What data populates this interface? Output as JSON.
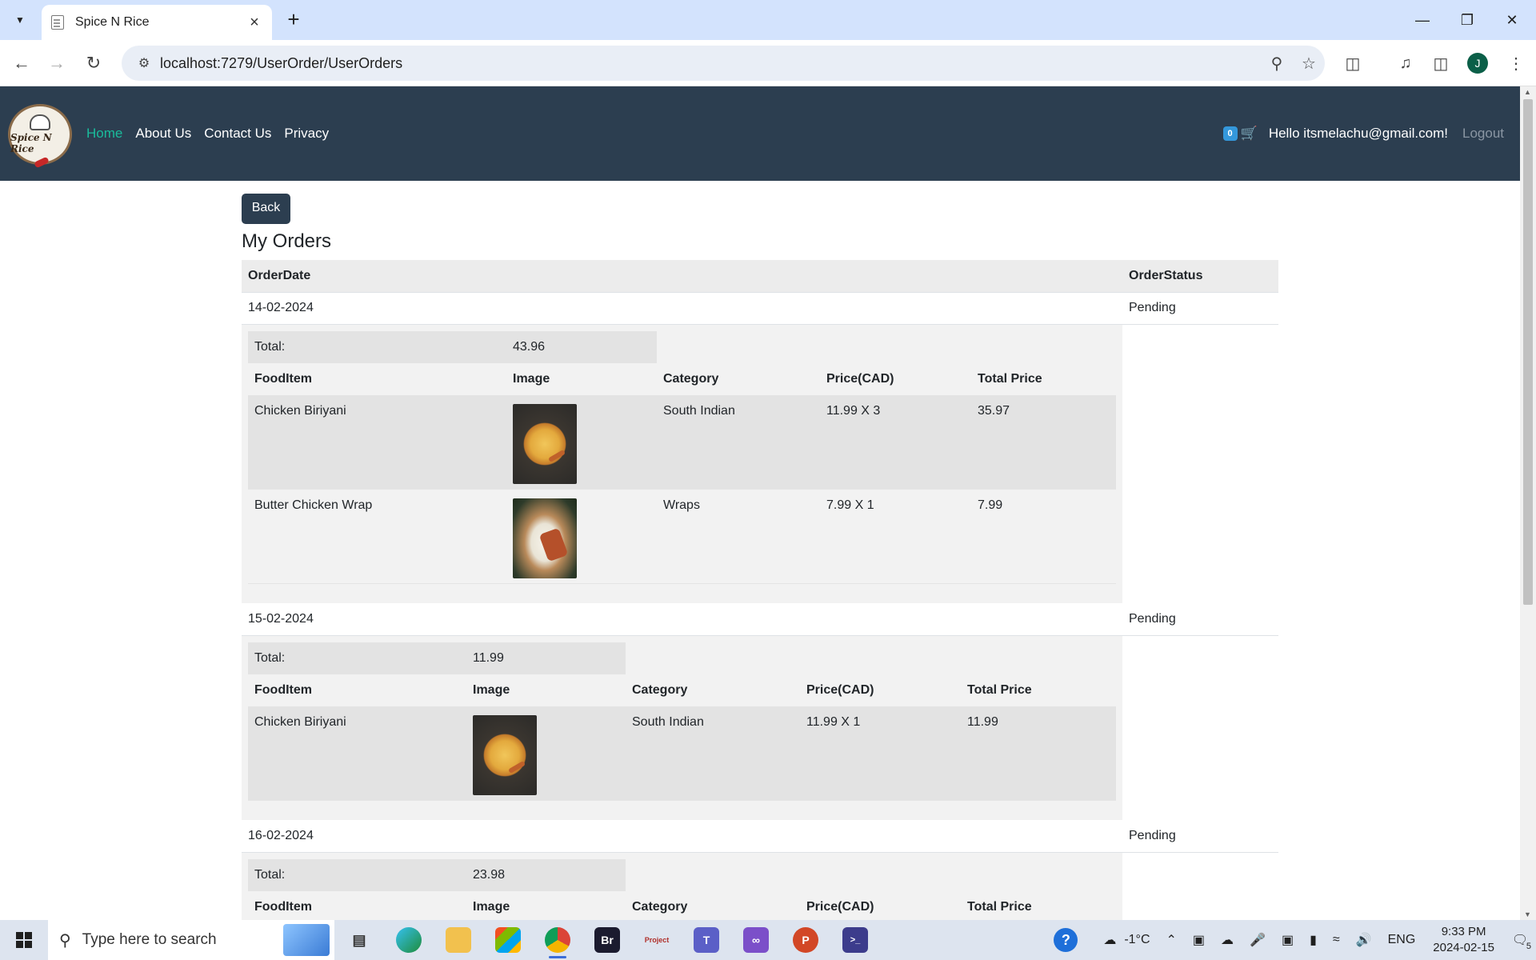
{
  "browser": {
    "tab_title": "Spice N Rice",
    "url": "localhost:7279/UserOrder/UserOrders",
    "profile_initial": "J"
  },
  "site": {
    "logo_text": "Spice N Rice",
    "nav": [
      "Home",
      "About Us",
      "Contact Us",
      "Privacy"
    ],
    "cart_count": "0",
    "greeting": "Hello itsmelachu@gmail.com!",
    "logout": "Logout",
    "colors": {
      "navbar": "#2c3e50",
      "active_link": "#1abc9c",
      "badge": "#3498db"
    }
  },
  "page": {
    "back_label": "Back",
    "title": "My Orders",
    "headers": {
      "order_date": "OrderDate",
      "order_status": "OrderStatus"
    },
    "detail_headers": {
      "food_item": "FoodItem",
      "image": "Image",
      "category": "Category",
      "price": "Price(CAD)",
      "total_price": "Total Price"
    },
    "total_label": "Total:"
  },
  "orders": [
    {
      "date": "14-02-2024",
      "status": "Pending",
      "total": "43.96",
      "items": [
        {
          "name": "Chicken Biriyani",
          "image": "biryani",
          "category": "South Indian",
          "price": "11.99 X 3",
          "total": "35.97"
        },
        {
          "name": "Butter Chicken Wrap",
          "image": "wrap",
          "category": "Wraps",
          "price": "7.99 X 1",
          "total": "7.99"
        }
      ]
    },
    {
      "date": "15-02-2024",
      "status": "Pending",
      "total": "11.99",
      "items": [
        {
          "name": "Chicken Biriyani",
          "image": "biryani",
          "category": "South Indian",
          "price": "11.99 X 1",
          "total": "11.99"
        }
      ]
    },
    {
      "date": "16-02-2024",
      "status": "Pending",
      "total": "23.98",
      "items": []
    }
  ],
  "taskbar": {
    "search_placeholder": "Type here to search",
    "weather": "-1°C",
    "language": "ENG",
    "time": "9:33 PM",
    "date": "2024-02-15",
    "notification_count": "5",
    "apps": [
      "task-view",
      "edge",
      "file-explorer",
      "store",
      "chrome",
      "bridge",
      "project",
      "teams",
      "visual-studio",
      "powerpoint",
      "terminal"
    ]
  }
}
